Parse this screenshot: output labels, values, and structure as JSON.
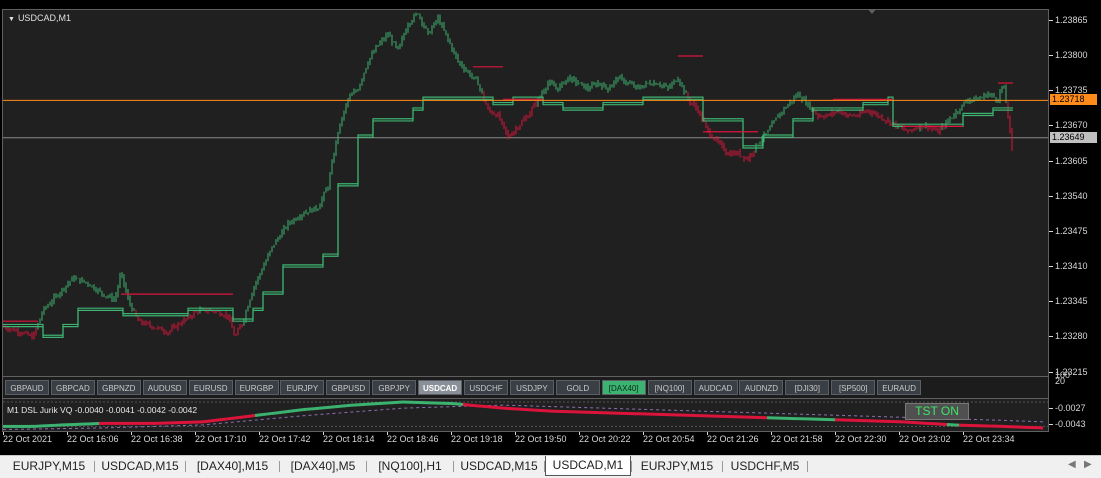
{
  "chart": {
    "title": "USDCAD,M1",
    "colors": {
      "bull": "#3cb371",
      "bear": "#dc143c",
      "background": "#202020",
      "orange_line": "#ff8c1a",
      "gray_line": "#8a8a8a"
    }
  },
  "price_axis": {
    "labels": [
      "1.23865",
      "1.23800",
      "1.23735",
      "1.23670",
      "1.23605",
      "1.23540",
      "1.23475",
      "1.23410",
      "1.23345",
      "1.23280",
      "1.23215"
    ],
    "ask_tag": "1.23718",
    "bid_tag": "1.23649"
  },
  "symbol_buttons": [
    {
      "label": "GBPAUD",
      "style": "normal"
    },
    {
      "label": "GBPCAD",
      "style": "normal"
    },
    {
      "label": "GBPNZD",
      "style": "normal"
    },
    {
      "label": "AUDUSD",
      "style": "normal"
    },
    {
      "label": "EURUSD",
      "style": "normal"
    },
    {
      "label": "EURGBP",
      "style": "normal"
    },
    {
      "label": "EURJPY",
      "style": "normal"
    },
    {
      "label": "GBPUSD",
      "style": "normal"
    },
    {
      "label": "GBPJPY",
      "style": "normal"
    },
    {
      "label": "USDCAD",
      "style": "active"
    },
    {
      "label": "USDCHF",
      "style": "normal"
    },
    {
      "label": "USDJPY",
      "style": "normal"
    },
    {
      "label": "GOLD",
      "style": "normal"
    },
    {
      "label": "[DAX40]",
      "style": "green"
    },
    {
      "label": "[NQ100]",
      "style": "normal"
    },
    {
      "label": "AUDCAD",
      "style": "normal"
    },
    {
      "label": "AUDNZD",
      "style": "normal"
    },
    {
      "label": "[DJI30]",
      "style": "normal"
    },
    {
      "label": "[SP500]",
      "style": "normal"
    },
    {
      "label": "EURAUD",
      "style": "normal"
    }
  ],
  "indicator": {
    "label": "M1 DSL Jurik VQ -0.0040 -0.0041 -0.0042 -0.0042",
    "scale_top": "100",
    "scale_second": "20",
    "level_1": "-0.0027",
    "level_2": "-0.0043",
    "button_label": "TST ON"
  },
  "time_axis": {
    "labels": [
      "22 Oct 2021",
      "22 Oct 16:06",
      "22 Oct 16:38",
      "22 Oct 17:10",
      "22 Oct 17:42",
      "22 Oct 18:14",
      "22 Oct 18:46",
      "22 Oct 19:18",
      "22 Oct 19:50",
      "22 Oct 20:22",
      "22 Oct 20:54",
      "22 Oct 21:26",
      "22 Oct 21:58",
      "22 Oct 22:30",
      "22 Oct 23:02",
      "22 Oct 23:34"
    ]
  },
  "tabs": [
    {
      "label": "EURJPY,M15",
      "active": false
    },
    {
      "label": "USDCAD,M15",
      "active": false
    },
    {
      "label": "[DAX40],M15",
      "active": false
    },
    {
      "label": "[DAX40],M5",
      "active": false
    },
    {
      "label": "[NQ100],H1",
      "active": false
    },
    {
      "label": "USDCAD,M15",
      "active": false
    },
    {
      "label": "USDCAD,M1",
      "active": true
    },
    {
      "label": "EURJPY,M15",
      "active": false
    },
    {
      "label": "USDCHF,M5",
      "active": false
    }
  ],
  "series": {
    "path_points": [
      [
        0,
        1.233
      ],
      [
        18,
        1.2329
      ],
      [
        30,
        1.2328
      ],
      [
        40,
        1.2333
      ],
      [
        55,
        1.2336
      ],
      [
        70,
        1.2339
      ],
      [
        85,
        1.2338
      ],
      [
        100,
        1.2336
      ],
      [
        112,
        1.2335
      ],
      [
        118,
        1.234
      ],
      [
        125,
        1.2335
      ],
      [
        135,
        1.2331
      ],
      [
        150,
        1.233
      ],
      [
        165,
        1.2329
      ],
      [
        180,
        1.2331
      ],
      [
        195,
        1.2333
      ],
      [
        210,
        1.2333
      ],
      [
        225,
        1.2332
      ],
      [
        232,
        1.2328
      ],
      [
        240,
        1.2331
      ],
      [
        250,
        1.2337
      ],
      [
        260,
        1.2341
      ],
      [
        270,
        1.2345
      ],
      [
        285,
        1.2349
      ],
      [
        300,
        1.2351
      ],
      [
        315,
        1.2352
      ],
      [
        325,
        1.2356
      ],
      [
        335,
        1.2366
      ],
      [
        345,
        1.2372
      ],
      [
        355,
        1.2374
      ],
      [
        365,
        1.2379
      ],
      [
        375,
        1.2382
      ],
      [
        385,
        1.2384
      ],
      [
        395,
        1.2381
      ],
      [
        405,
        1.2386
      ],
      [
        415,
        1.2388
      ],
      [
        425,
        1.2384
      ],
      [
        435,
        1.2387
      ],
      [
        445,
        1.2383
      ],
      [
        455,
        1.2379
      ],
      [
        465,
        1.2377
      ],
      [
        475,
        1.2375
      ],
      [
        485,
        1.237
      ],
      [
        495,
        1.2369
      ],
      [
        505,
        1.2365
      ],
      [
        515,
        1.2367
      ],
      [
        525,
        1.2369
      ],
      [
        535,
        1.2372
      ],
      [
        545,
        1.2375
      ],
      [
        555,
        1.2374
      ],
      [
        565,
        1.2376
      ],
      [
        575,
        1.2375
      ],
      [
        585,
        1.2374
      ],
      [
        595,
        1.2375
      ],
      [
        605,
        1.2374
      ],
      [
        615,
        1.2376
      ],
      [
        625,
        1.2375
      ],
      [
        635,
        1.2374
      ],
      [
        645,
        1.2375
      ],
      [
        655,
        1.2375
      ],
      [
        665,
        1.2374
      ],
      [
        675,
        1.2376
      ],
      [
        685,
        1.2372
      ],
      [
        695,
        1.237
      ],
      [
        705,
        1.2366
      ],
      [
        715,
        1.2364
      ],
      [
        725,
        1.2362
      ],
      [
        735,
        1.2362
      ],
      [
        745,
        1.2361
      ],
      [
        755,
        1.2364
      ],
      [
        765,
        1.2366
      ],
      [
        775,
        1.2369
      ],
      [
        785,
        1.2371
      ],
      [
        795,
        1.2373
      ],
      [
        805,
        1.2371
      ],
      [
        815,
        1.2369
      ],
      [
        825,
        1.2369
      ],
      [
        835,
        1.237
      ],
      [
        845,
        1.2369
      ],
      [
        855,
        1.2369
      ],
      [
        865,
        1.237
      ],
      [
        875,
        1.2369
      ],
      [
        885,
        1.2368
      ],
      [
        895,
        1.2367
      ],
      [
        905,
        1.2366
      ],
      [
        915,
        1.2367
      ],
      [
        925,
        1.2367
      ],
      [
        935,
        1.2366
      ],
      [
        945,
        1.2368
      ],
      [
        955,
        1.237
      ],
      [
        965,
        1.2372
      ],
      [
        975,
        1.2372
      ],
      [
        985,
        1.2373
      ],
      [
        995,
        1.2372
      ],
      [
        1000,
        1.2375
      ],
      [
        1005,
        1.2369
      ],
      [
        1010,
        1.2361
      ]
    ],
    "steps": [
      [
        0,
        1.233
      ],
      [
        35,
        1.233
      ],
      [
        40,
        1.2328
      ],
      [
        60,
        1.233
      ],
      [
        75,
        1.2333
      ],
      [
        120,
        1.2332
      ],
      [
        185,
        1.2333
      ],
      [
        230,
        1.2331
      ],
      [
        245,
        1.2331
      ],
      [
        250,
        1.2333
      ],
      [
        260,
        1.2336
      ],
      [
        280,
        1.2341
      ],
      [
        320,
        1.2343
      ],
      [
        335,
        1.2356
      ],
      [
        355,
        1.2365
      ],
      [
        370,
        1.2368
      ],
      [
        395,
        1.2368
      ],
      [
        410,
        1.237
      ],
      [
        420,
        1.2372
      ],
      [
        470,
        1.2372
      ],
      [
        490,
        1.2371
      ],
      [
        510,
        1.2372
      ],
      [
        540,
        1.2371
      ],
      [
        560,
        1.237
      ],
      [
        600,
        1.2371
      ],
      [
        640,
        1.2372
      ],
      [
        680,
        1.2372
      ],
      [
        700,
        1.2368
      ],
      [
        740,
        1.2363
      ],
      [
        760,
        1.2365
      ],
      [
        790,
        1.2368
      ],
      [
        810,
        1.237
      ],
      [
        840,
        1.237
      ],
      [
        860,
        1.2371
      ],
      [
        885,
        1.2372
      ],
      [
        890,
        1.2367
      ],
      [
        940,
        1.2367
      ],
      [
        960,
        1.2369
      ],
      [
        990,
        1.237
      ],
      [
        1010,
        1.237
      ]
    ],
    "osc_points": [
      [
        0,
        -0.0043
      ],
      [
        30,
        -0.0043
      ],
      [
        60,
        -0.0042
      ],
      [
        100,
        -0.0041
      ],
      [
        150,
        -0.0041
      ],
      [
        200,
        -0.004
      ],
      [
        250,
        -0.0036
      ],
      [
        300,
        -0.0032
      ],
      [
        350,
        -0.0029
      ],
      [
        400,
        -0.0027
      ],
      [
        450,
        -0.0028
      ],
      [
        500,
        -0.0031
      ],
      [
        550,
        -0.0033
      ],
      [
        600,
        -0.0034
      ],
      [
        650,
        -0.0035
      ],
      [
        700,
        -0.0036
      ],
      [
        750,
        -0.0037
      ],
      [
        800,
        -0.0038
      ],
      [
        850,
        -0.0039
      ],
      [
        900,
        -0.004
      ],
      [
        950,
        -0.0042
      ],
      [
        1000,
        -0.0043
      ],
      [
        1040,
        -0.0044
      ]
    ],
    "osc_dashed": [
      [
        0,
        -0.0045
      ],
      [
        100,
        -0.0044
      ],
      [
        200,
        -0.0042
      ],
      [
        300,
        -0.0036
      ],
      [
        400,
        -0.0031
      ],
      [
        500,
        -0.0029
      ],
      [
        600,
        -0.0031
      ],
      [
        700,
        -0.0033
      ],
      [
        800,
        -0.0035
      ],
      [
        900,
        -0.0037
      ],
      [
        1000,
        -0.0039
      ],
      [
        1040,
        -0.004
      ]
    ]
  }
}
